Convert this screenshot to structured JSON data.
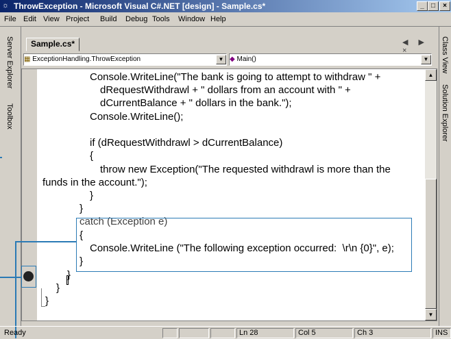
{
  "window": {
    "title": "ThrowException - Microsoft Visual C#.NET [design] - Sample.cs*",
    "minimize": "_",
    "maximize": "×",
    "restore": "□",
    "close": "×"
  },
  "menu": [
    "File",
    "Edit",
    "View",
    "Project",
    "Build",
    "Debug",
    "Tools",
    "Window",
    "Help"
  ],
  "left_panels": [
    "Server Explorer",
    "Toolbox"
  ],
  "right_panels": [
    "Class View",
    "Solution Explorer"
  ],
  "document": {
    "tab_label": "Sample.cs*",
    "tab_nav": "◀ ▶ ×",
    "class_combo": "ExceptionHandling.ThrowException",
    "member_combo": "Main()"
  },
  "code_lines": [
    "Console.WriteLine(\"The bank is going to attempt to withdraw \" +",
    "dRequestWithdrawl + \" dollars from an account with \" +",
    "dCurrentBalance + \" dollars in the bank.\");",
    "Console.WriteLine();",
    "if (dRequestWithdrawl > dCurrentBalance)",
    "{",
    "throw new Exception(\"The requested withdrawl is more than the",
    "funds in the account.\");",
    "}",
    "}",
    "catch (Exception e)",
    "{",
    "Console.WriteLine (\"The following exception occurred:  \\r\\n {0}\", e);",
    "}",
    "}",
    "}",
    "}"
  ],
  "status": {
    "ready": "Ready",
    "ln": "Ln 28",
    "col": "Col 5",
    "ch": "Ch 3",
    "mode": "INS"
  }
}
